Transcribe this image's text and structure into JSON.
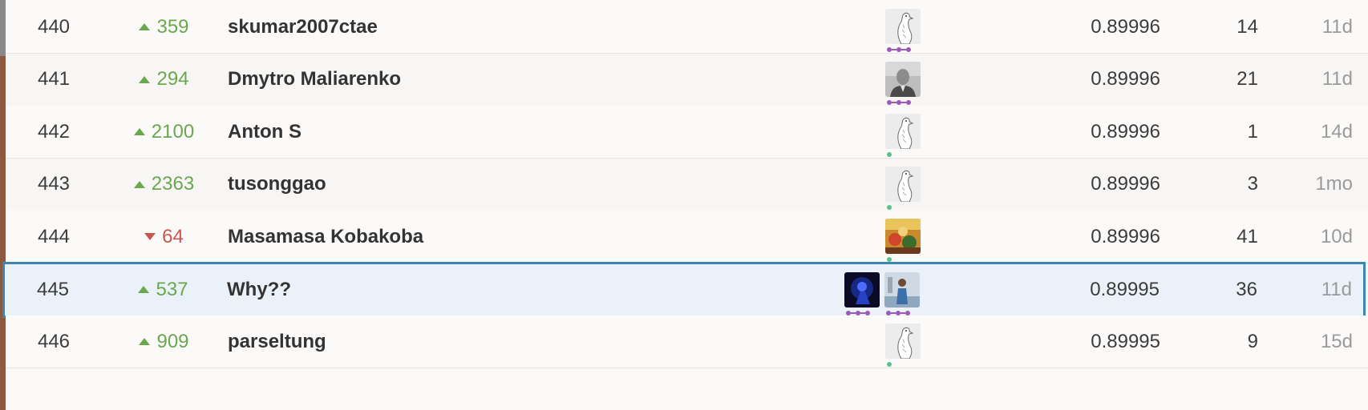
{
  "colors": {
    "rise": "#6aa84f",
    "fall": "#c8584f",
    "highlight_border": "#3c86b4",
    "highlight_bg": "#ebf1f8",
    "tier_master": "#9b59b6",
    "tier_novice": "#5cc08a"
  },
  "leaderboard": {
    "rows": [
      {
        "rank": "440",
        "direction": "up",
        "change": "359",
        "team": "skumar2007ctae",
        "avatars": [
          "goose-avatar"
        ],
        "tier": "purple",
        "score": "0.89996",
        "entries": "14",
        "last": "11d"
      },
      {
        "rank": "441",
        "direction": "up",
        "change": "294",
        "team": "Dmytro Maliarenko",
        "avatars": [
          "photo-avatar-gray"
        ],
        "tier": "purple",
        "score": "0.89996",
        "entries": "21",
        "last": "11d"
      },
      {
        "rank": "442",
        "direction": "up",
        "change": "2100",
        "team": "Anton S",
        "avatars": [
          "goose-avatar"
        ],
        "tier": "green",
        "score": "0.89996",
        "entries": "1",
        "last": "14d"
      },
      {
        "rank": "443",
        "direction": "up",
        "change": "2363",
        "team": "tusonggao",
        "avatars": [
          "goose-avatar"
        ],
        "tier": "green",
        "score": "0.89996",
        "entries": "3",
        "last": "1mo"
      },
      {
        "rank": "444",
        "direction": "down",
        "change": "64",
        "team": "Masamasa Kobakoba",
        "avatars": [
          "photo-avatar-colorful"
        ],
        "tier": "green",
        "score": "0.89996",
        "entries": "41",
        "last": "10d"
      },
      {
        "rank": "445",
        "direction": "up",
        "change": "537",
        "team": "Why??",
        "avatars": [
          "photo-avatar-blue",
          "photo-avatar-person"
        ],
        "tier": "purple",
        "score": "0.89995",
        "entries": "36",
        "last": "11d"
      },
      {
        "rank": "446",
        "direction": "up",
        "change": "909",
        "team": "parseltung",
        "avatars": [
          "goose-avatar"
        ],
        "tier": "green",
        "score": "0.89995",
        "entries": "9",
        "last": "15d"
      }
    ]
  }
}
